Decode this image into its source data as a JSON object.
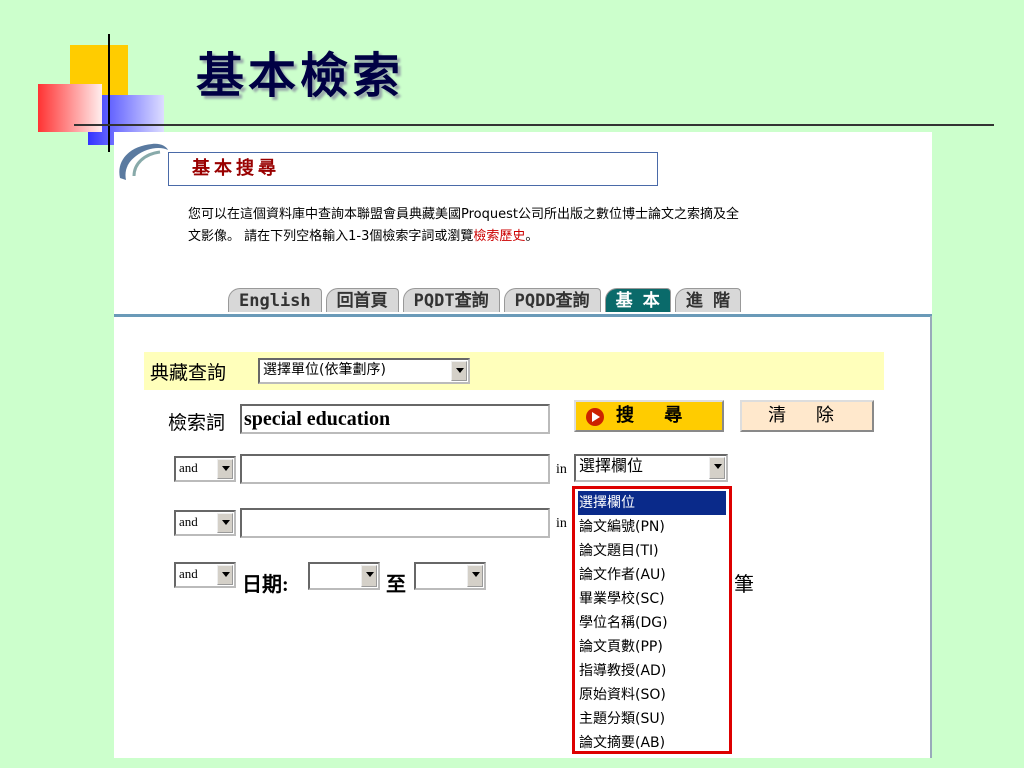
{
  "slide": {
    "title": "基本檢索"
  },
  "header": {
    "section_title": "基本搜尋",
    "description_line1": "您可以在這個資料庫中查詢本聯盟會員典藏美國Proquest公司所出版之數位博士論文之索摘及全",
    "description_line2_prefix": "文影像。 請在下列空格輸入1-3個檢索字詞或瀏覽",
    "history_link": "檢索歷史",
    "description_line2_suffix": "。"
  },
  "tabs": [
    {
      "label": "English",
      "active": false
    },
    {
      "label": "回首頁",
      "active": false
    },
    {
      "label": "PQDT查詢",
      "active": false
    },
    {
      "label": "PQDD查詢",
      "active": false
    },
    {
      "label": "基 本",
      "active": true
    },
    {
      "label": "進 階",
      "active": false
    }
  ],
  "form": {
    "collection_label": "典藏查詢",
    "collection_select": "選擇單位(依筆劃序)",
    "keyword_label": "檢索詞",
    "keyword_value": "special education",
    "search_button": "搜 尋",
    "clear_button": "清 除",
    "rows": [
      {
        "operator": "and",
        "value": "",
        "in_label": "in",
        "field": "選擇欄位"
      },
      {
        "operator": "and",
        "value": "",
        "in_label": "in"
      }
    ],
    "date_row": {
      "operator": "and",
      "date_label": "日期:",
      "from": "",
      "to_label": "至",
      "to": ""
    },
    "partial_text": "筆"
  },
  "field_dropdown": {
    "options": [
      "選擇欄位",
      "論文編號(PN)",
      "論文題目(TI)",
      "論文作者(AU)",
      "畢業學校(SC)",
      "學位名稱(DG)",
      "論文頁數(PP)",
      "指導教授(AD)",
      "原始資料(SO)",
      "主題分類(SU)",
      "論文摘要(AB)"
    ],
    "selected": 0
  },
  "colors": {
    "slide_bg": "#ccffcc",
    "highlight_border": "#dd0000",
    "active_tab": "#0a6a6a",
    "search_button": "#ffcc00",
    "clear_button": "#ffe8cc"
  }
}
